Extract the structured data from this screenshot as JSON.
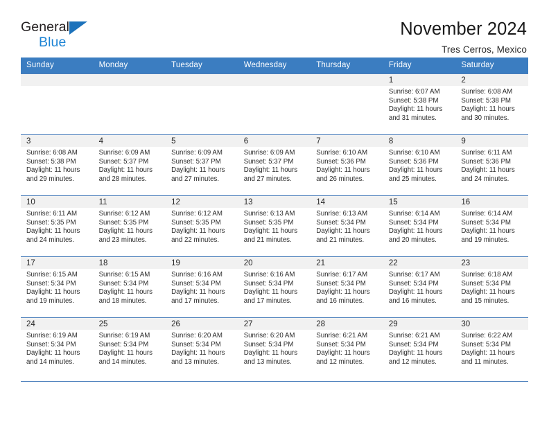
{
  "brand": {
    "name_part1": "General",
    "name_part2": "Blue",
    "triangle_color": "#1c72bb",
    "blue_color": "#1c83d4"
  },
  "header": {
    "title": "November 2024",
    "subtitle": "Tres Cerros, Mexico"
  },
  "theme": {
    "header_bg": "#3b7dc1",
    "header_text": "#ffffff",
    "row_border": "#4a7ebb",
    "daynum_bg": "#f1f1f1",
    "cell_bg": "#ffffff"
  },
  "calendar": {
    "weekday_headers": [
      "Sunday",
      "Monday",
      "Tuesday",
      "Wednesday",
      "Thursday",
      "Friday",
      "Saturday"
    ],
    "labels": {
      "sunrise": "Sunrise:",
      "sunset": "Sunset:",
      "daylight": "Daylight:"
    },
    "weeks": [
      [
        {
          "day": "",
          "sunrise": "",
          "sunset": "",
          "daylight_line1": "",
          "daylight_line2": "",
          "empty": true
        },
        {
          "day": "",
          "sunrise": "",
          "sunset": "",
          "daylight_line1": "",
          "daylight_line2": "",
          "empty": true
        },
        {
          "day": "",
          "sunrise": "",
          "sunset": "",
          "daylight_line1": "",
          "daylight_line2": "",
          "empty": true
        },
        {
          "day": "",
          "sunrise": "",
          "sunset": "",
          "daylight_line1": "",
          "daylight_line2": "",
          "empty": true
        },
        {
          "day": "",
          "sunrise": "",
          "sunset": "",
          "daylight_line1": "",
          "daylight_line2": "",
          "empty": true
        },
        {
          "day": "1",
          "sunrise": "Sunrise: 6:07 AM",
          "sunset": "Sunset: 5:38 PM",
          "daylight_line1": "Daylight: 11 hours",
          "daylight_line2": "and 31 minutes.",
          "empty": false
        },
        {
          "day": "2",
          "sunrise": "Sunrise: 6:08 AM",
          "sunset": "Sunset: 5:38 PM",
          "daylight_line1": "Daylight: 11 hours",
          "daylight_line2": "and 30 minutes.",
          "empty": false
        }
      ],
      [
        {
          "day": "3",
          "sunrise": "Sunrise: 6:08 AM",
          "sunset": "Sunset: 5:38 PM",
          "daylight_line1": "Daylight: 11 hours",
          "daylight_line2": "and 29 minutes.",
          "empty": false
        },
        {
          "day": "4",
          "sunrise": "Sunrise: 6:09 AM",
          "sunset": "Sunset: 5:37 PM",
          "daylight_line1": "Daylight: 11 hours",
          "daylight_line2": "and 28 minutes.",
          "empty": false
        },
        {
          "day": "5",
          "sunrise": "Sunrise: 6:09 AM",
          "sunset": "Sunset: 5:37 PM",
          "daylight_line1": "Daylight: 11 hours",
          "daylight_line2": "and 27 minutes.",
          "empty": false
        },
        {
          "day": "6",
          "sunrise": "Sunrise: 6:09 AM",
          "sunset": "Sunset: 5:37 PM",
          "daylight_line1": "Daylight: 11 hours",
          "daylight_line2": "and 27 minutes.",
          "empty": false
        },
        {
          "day": "7",
          "sunrise": "Sunrise: 6:10 AM",
          "sunset": "Sunset: 5:36 PM",
          "daylight_line1": "Daylight: 11 hours",
          "daylight_line2": "and 26 minutes.",
          "empty": false
        },
        {
          "day": "8",
          "sunrise": "Sunrise: 6:10 AM",
          "sunset": "Sunset: 5:36 PM",
          "daylight_line1": "Daylight: 11 hours",
          "daylight_line2": "and 25 minutes.",
          "empty": false
        },
        {
          "day": "9",
          "sunrise": "Sunrise: 6:11 AM",
          "sunset": "Sunset: 5:36 PM",
          "daylight_line1": "Daylight: 11 hours",
          "daylight_line2": "and 24 minutes.",
          "empty": false
        }
      ],
      [
        {
          "day": "10",
          "sunrise": "Sunrise: 6:11 AM",
          "sunset": "Sunset: 5:35 PM",
          "daylight_line1": "Daylight: 11 hours",
          "daylight_line2": "and 24 minutes.",
          "empty": false
        },
        {
          "day": "11",
          "sunrise": "Sunrise: 6:12 AM",
          "sunset": "Sunset: 5:35 PM",
          "daylight_line1": "Daylight: 11 hours",
          "daylight_line2": "and 23 minutes.",
          "empty": false
        },
        {
          "day": "12",
          "sunrise": "Sunrise: 6:12 AM",
          "sunset": "Sunset: 5:35 PM",
          "daylight_line1": "Daylight: 11 hours",
          "daylight_line2": "and 22 minutes.",
          "empty": false
        },
        {
          "day": "13",
          "sunrise": "Sunrise: 6:13 AM",
          "sunset": "Sunset: 5:35 PM",
          "daylight_line1": "Daylight: 11 hours",
          "daylight_line2": "and 21 minutes.",
          "empty": false
        },
        {
          "day": "14",
          "sunrise": "Sunrise: 6:13 AM",
          "sunset": "Sunset: 5:34 PM",
          "daylight_line1": "Daylight: 11 hours",
          "daylight_line2": "and 21 minutes.",
          "empty": false
        },
        {
          "day": "15",
          "sunrise": "Sunrise: 6:14 AM",
          "sunset": "Sunset: 5:34 PM",
          "daylight_line1": "Daylight: 11 hours",
          "daylight_line2": "and 20 minutes.",
          "empty": false
        },
        {
          "day": "16",
          "sunrise": "Sunrise: 6:14 AM",
          "sunset": "Sunset: 5:34 PM",
          "daylight_line1": "Daylight: 11 hours",
          "daylight_line2": "and 19 minutes.",
          "empty": false
        }
      ],
      [
        {
          "day": "17",
          "sunrise": "Sunrise: 6:15 AM",
          "sunset": "Sunset: 5:34 PM",
          "daylight_line1": "Daylight: 11 hours",
          "daylight_line2": "and 19 minutes.",
          "empty": false
        },
        {
          "day": "18",
          "sunrise": "Sunrise: 6:15 AM",
          "sunset": "Sunset: 5:34 PM",
          "daylight_line1": "Daylight: 11 hours",
          "daylight_line2": "and 18 minutes.",
          "empty": false
        },
        {
          "day": "19",
          "sunrise": "Sunrise: 6:16 AM",
          "sunset": "Sunset: 5:34 PM",
          "daylight_line1": "Daylight: 11 hours",
          "daylight_line2": "and 17 minutes.",
          "empty": false
        },
        {
          "day": "20",
          "sunrise": "Sunrise: 6:16 AM",
          "sunset": "Sunset: 5:34 PM",
          "daylight_line1": "Daylight: 11 hours",
          "daylight_line2": "and 17 minutes.",
          "empty": false
        },
        {
          "day": "21",
          "sunrise": "Sunrise: 6:17 AM",
          "sunset": "Sunset: 5:34 PM",
          "daylight_line1": "Daylight: 11 hours",
          "daylight_line2": "and 16 minutes.",
          "empty": false
        },
        {
          "day": "22",
          "sunrise": "Sunrise: 6:17 AM",
          "sunset": "Sunset: 5:34 PM",
          "daylight_line1": "Daylight: 11 hours",
          "daylight_line2": "and 16 minutes.",
          "empty": false
        },
        {
          "day": "23",
          "sunrise": "Sunrise: 6:18 AM",
          "sunset": "Sunset: 5:34 PM",
          "daylight_line1": "Daylight: 11 hours",
          "daylight_line2": "and 15 minutes.",
          "empty": false
        }
      ],
      [
        {
          "day": "24",
          "sunrise": "Sunrise: 6:19 AM",
          "sunset": "Sunset: 5:34 PM",
          "daylight_line1": "Daylight: 11 hours",
          "daylight_line2": "and 14 minutes.",
          "empty": false
        },
        {
          "day": "25",
          "sunrise": "Sunrise: 6:19 AM",
          "sunset": "Sunset: 5:34 PM",
          "daylight_line1": "Daylight: 11 hours",
          "daylight_line2": "and 14 minutes.",
          "empty": false
        },
        {
          "day": "26",
          "sunrise": "Sunrise: 6:20 AM",
          "sunset": "Sunset: 5:34 PM",
          "daylight_line1": "Daylight: 11 hours",
          "daylight_line2": "and 13 minutes.",
          "empty": false
        },
        {
          "day": "27",
          "sunrise": "Sunrise: 6:20 AM",
          "sunset": "Sunset: 5:34 PM",
          "daylight_line1": "Daylight: 11 hours",
          "daylight_line2": "and 13 minutes.",
          "empty": false
        },
        {
          "day": "28",
          "sunrise": "Sunrise: 6:21 AM",
          "sunset": "Sunset: 5:34 PM",
          "daylight_line1": "Daylight: 11 hours",
          "daylight_line2": "and 12 minutes.",
          "empty": false
        },
        {
          "day": "29",
          "sunrise": "Sunrise: 6:21 AM",
          "sunset": "Sunset: 5:34 PM",
          "daylight_line1": "Daylight: 11 hours",
          "daylight_line2": "and 12 minutes.",
          "empty": false
        },
        {
          "day": "30",
          "sunrise": "Sunrise: 6:22 AM",
          "sunset": "Sunset: 5:34 PM",
          "daylight_line1": "Daylight: 11 hours",
          "daylight_line2": "and 11 minutes.",
          "empty": false
        }
      ]
    ]
  }
}
